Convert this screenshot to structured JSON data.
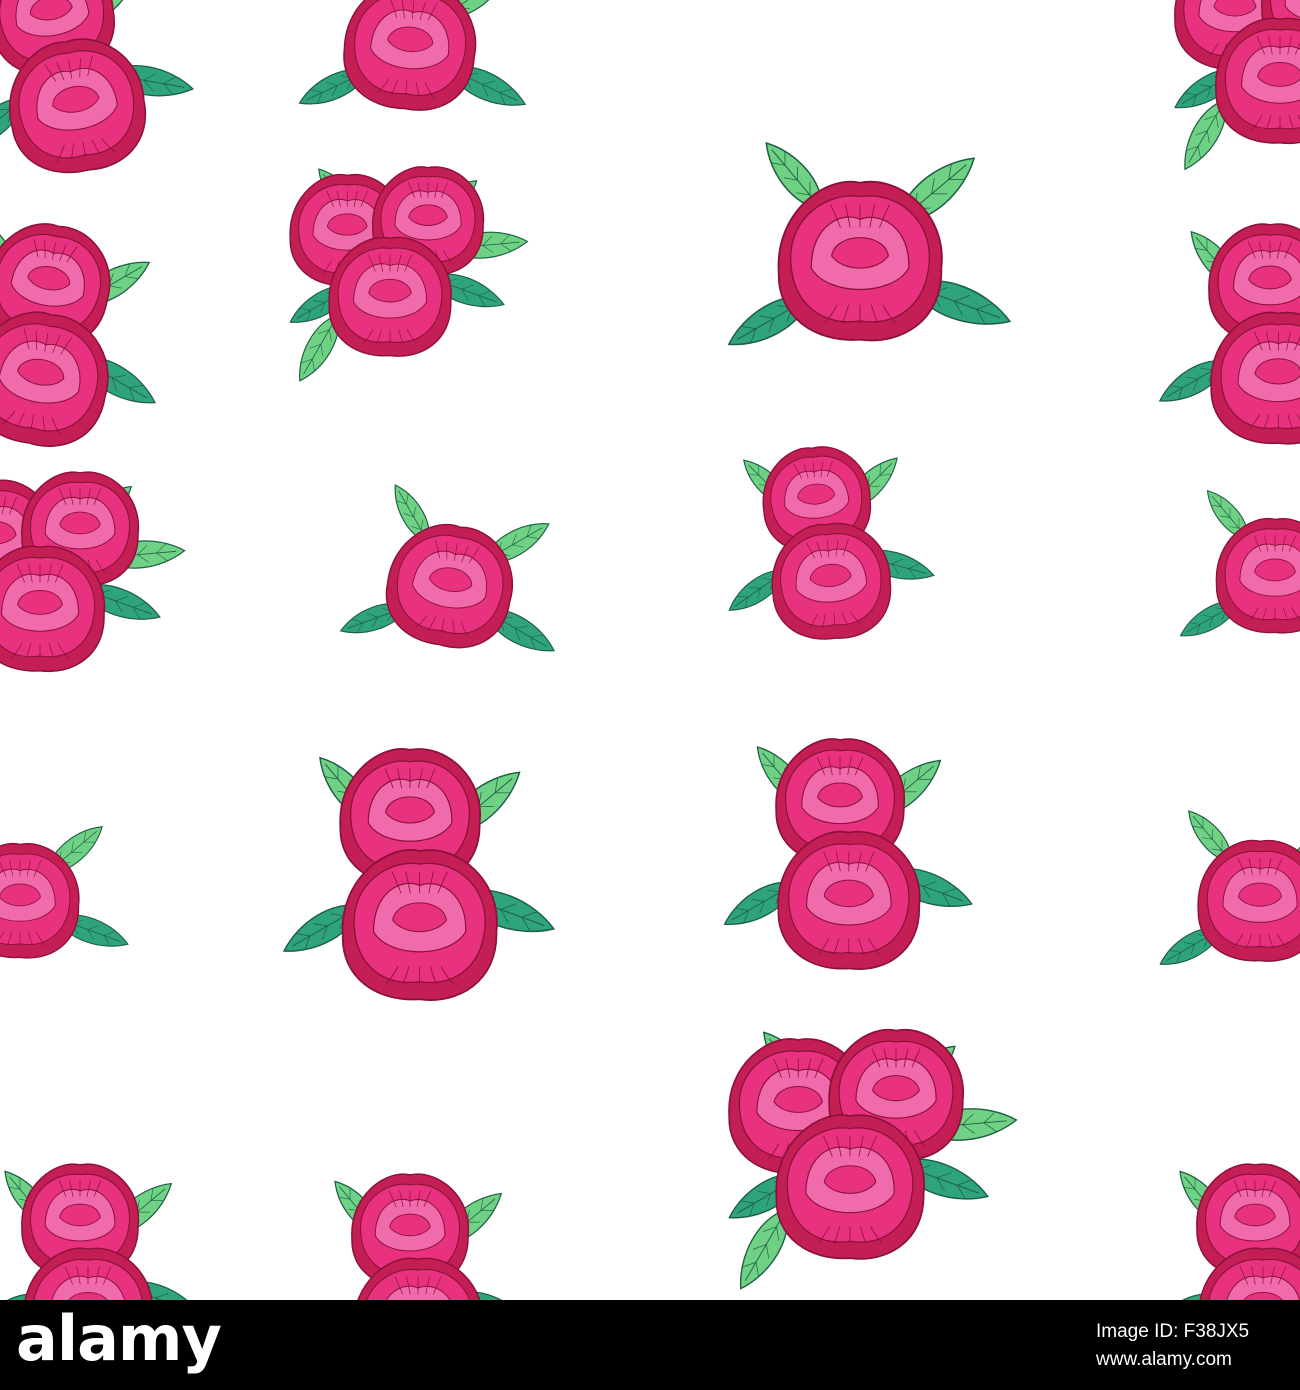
{
  "image": {
    "subject": "seamless pattern of pink peony bouquets with green leaves",
    "background": "#ffffff",
    "colors": {
      "petal_light": "#f06bab",
      "petal_mid": "#e8327f",
      "petal_dark": "#c41f55",
      "outline": "#8a1238",
      "leaf_green": "#6ed183",
      "leaf_teal": "#2fa37a"
    },
    "bouquets": [
      {
        "kind": "double"
      },
      {
        "kind": "single"
      },
      {
        "kind": "cluster"
      },
      {
        "kind": "single"
      },
      {
        "kind": "double"
      },
      {
        "kind": "single"
      },
      {
        "kind": "cluster"
      },
      {
        "kind": "double"
      },
      {
        "kind": "double"
      }
    ]
  },
  "watermark": {
    "logo": "alamy",
    "image_id": "Image ID: F38JX5",
    "url": "www.alamy.com"
  }
}
